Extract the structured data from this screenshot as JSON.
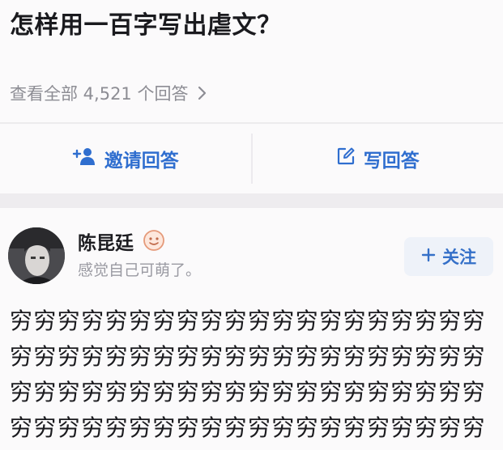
{
  "question": {
    "title": "怎样用一百字写出虐文？",
    "view_all_label": "查看全部 4,521 个回答"
  },
  "actions": {
    "invite_label": "邀请回答",
    "write_label": "写回答"
  },
  "answer": {
    "author_name": "陈昆廷",
    "author_bio": "感觉自己可萌了。",
    "follow_label": "关注",
    "body_text": "穷穷穷穷穷穷穷穷穷穷穷穷穷穷穷穷穷穷穷穷穷穷穷穷穷穷穷穷穷穷穷穷穷穷穷穷穷穷穷穷穷穷穷穷穷穷穷穷穷穷穷穷穷穷穷穷穷穷穷穷穷穷穷穷穷穷穷穷穷穷穷穷穷穷穷穷穷穷穷穷"
  },
  "icons": {
    "invite": "add-person-icon",
    "write": "edit-pencil-icon",
    "follow": "plus-icon",
    "badge": "smiley-badge-icon",
    "view_all": "chevron-right-icon"
  },
  "colors": {
    "accent": "#2f6ecf",
    "text_primary": "#1b1b1f",
    "text_secondary": "#8d8d94",
    "background": "#f7f5f6"
  }
}
